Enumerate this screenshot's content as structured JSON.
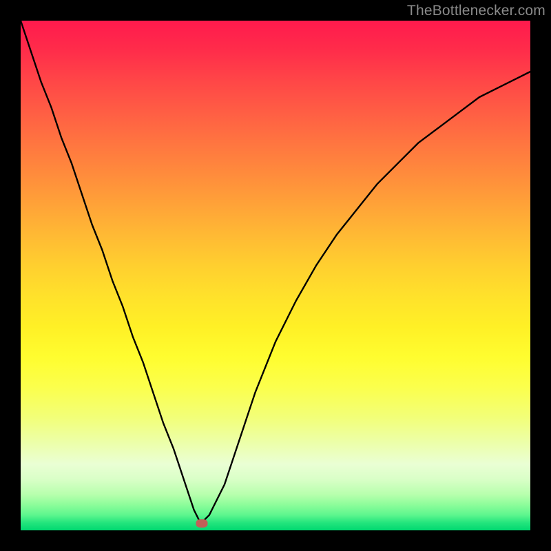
{
  "watermark": "TheBottlenecker.com",
  "marker": {
    "x_pct": 35.5,
    "y_pct": 98.6
  },
  "chart_data": {
    "type": "line",
    "title": "",
    "xlabel": "",
    "ylabel": "",
    "xlim": [
      0,
      100
    ],
    "ylim": [
      0,
      100
    ],
    "legend": false,
    "grid": false,
    "background_gradient": {
      "top": "#ff1a4d",
      "bottom": "#00d870"
    },
    "series": [
      {
        "name": "bottleneck-curve",
        "x": [
          0,
          2,
          4,
          6,
          8,
          10,
          12,
          14,
          16,
          18,
          20,
          22,
          24,
          26,
          28,
          30,
          32,
          33,
          34,
          35,
          35.5,
          36,
          37,
          38,
          40,
          42,
          44,
          46,
          48,
          50,
          54,
          58,
          62,
          66,
          70,
          74,
          78,
          82,
          86,
          90,
          94,
          98,
          100
        ],
        "y": [
          100,
          94,
          88,
          83,
          77,
          72,
          66,
          60,
          55,
          49,
          44,
          38,
          33,
          27,
          21,
          16,
          10,
          7,
          4,
          2,
          1.5,
          2,
          3,
          5,
          9,
          15,
          21,
          27,
          32,
          37,
          45,
          52,
          58,
          63,
          68,
          72,
          76,
          79,
          82,
          85,
          87,
          89,
          90
        ]
      }
    ],
    "annotations": [
      {
        "type": "marker",
        "x": 35.5,
        "y": 1.4,
        "color": "#c06058"
      }
    ]
  }
}
